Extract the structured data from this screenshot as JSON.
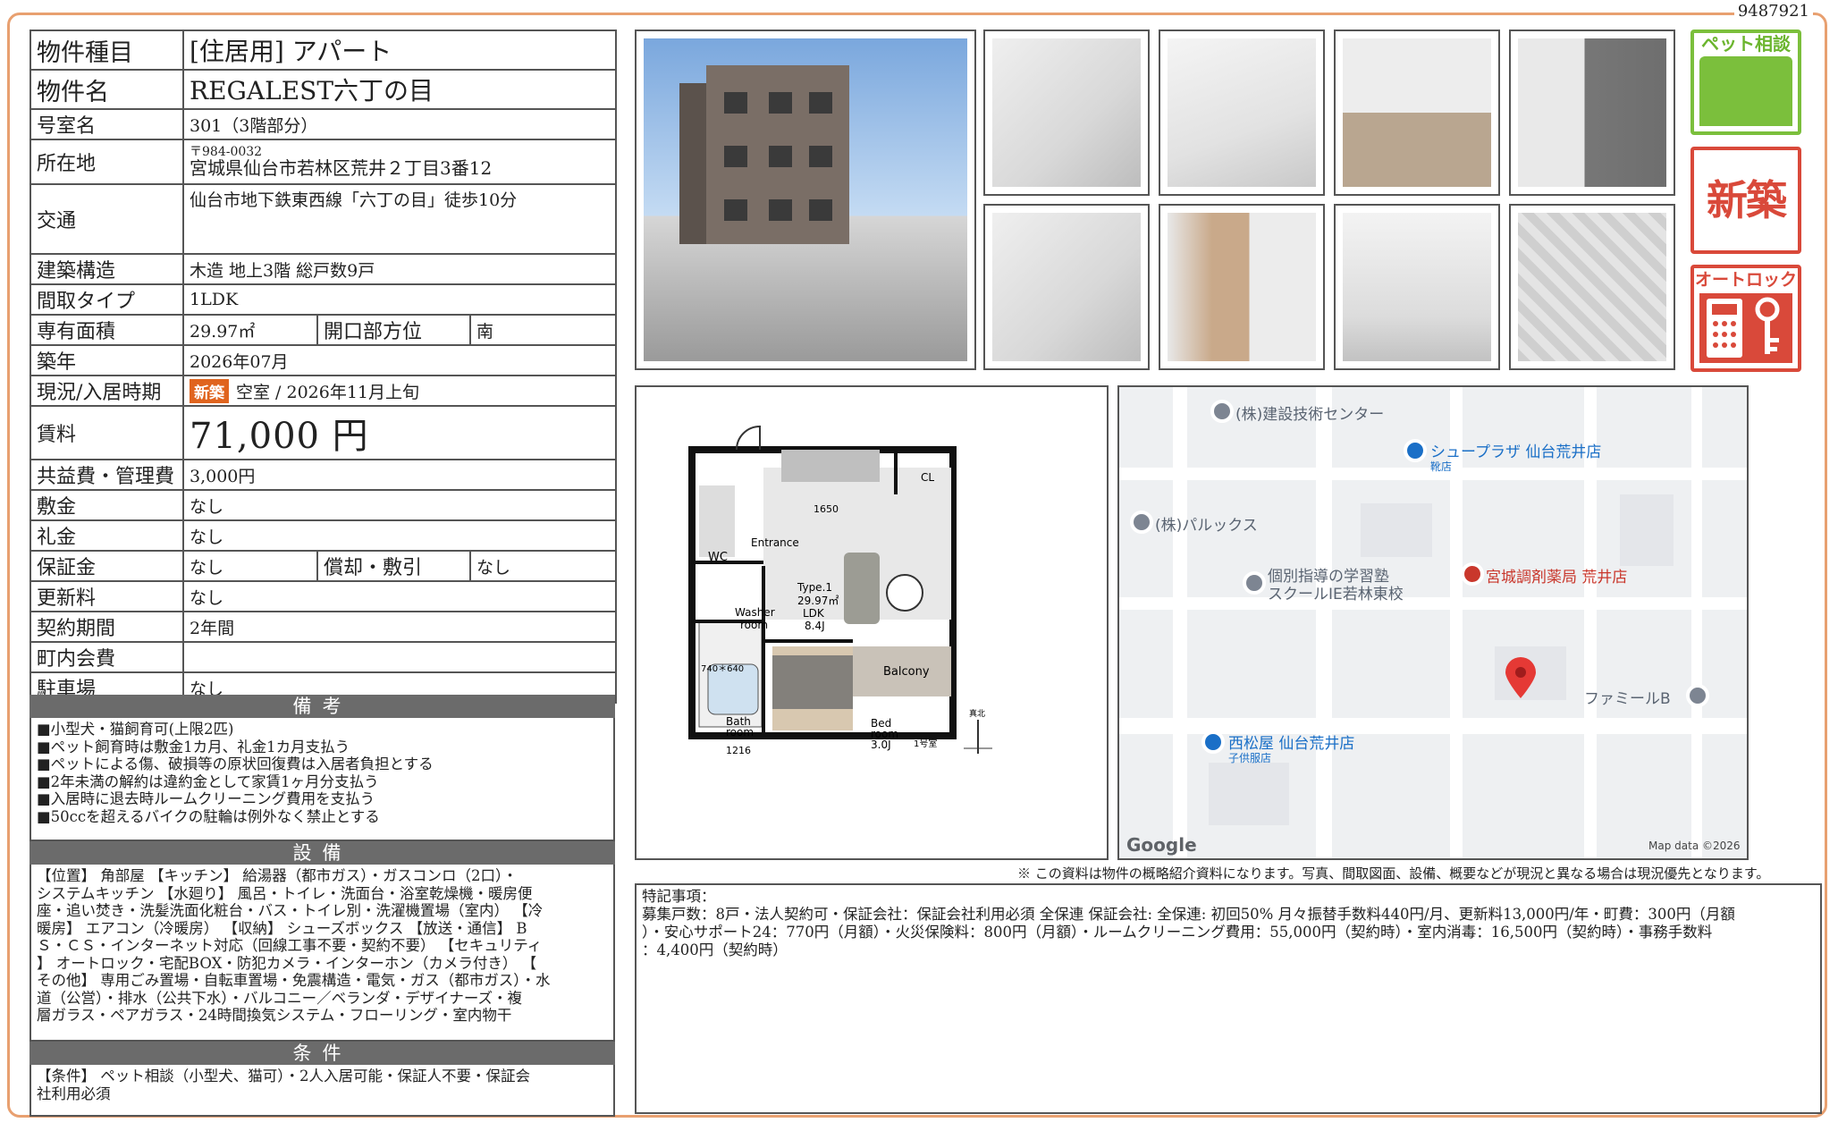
{
  "doc_id": "9487921",
  "rows": {
    "type": {
      "key": "物件種目",
      "val": "[住居用]  アパート"
    },
    "name": {
      "key": "物件名",
      "val": "REGALEST六丁の目"
    },
    "room": {
      "key": "号室名",
      "val": "301（3階部分）"
    },
    "address": {
      "key": "所在地",
      "zip": "〒984-0032",
      "val": "宮城県仙台市若林区荒井２丁目3番12"
    },
    "transport": {
      "key": "交通",
      "val": "仙台市地下鉄東西線「六丁の目」徒歩10分"
    },
    "structure": {
      "key": "建築構造",
      "val": "木造  地上3階  総戸数9戸"
    },
    "layout": {
      "key": "間取タイプ",
      "val": "1LDK"
    },
    "area": {
      "key": "専有面積",
      "val": "29.97㎡",
      "key2": "開口部方位",
      "val2": "南"
    },
    "built": {
      "key": "築年",
      "val": "2026年07月"
    },
    "status": {
      "key": "現況/入居時期",
      "badge": "新築",
      "val": "空室  /   2026年11月上旬"
    },
    "rent": {
      "key": "賃料",
      "val": "71,000 円"
    },
    "fee": {
      "key": "共益費・管理費",
      "val": "3,000円"
    },
    "deposit": {
      "key": "敷金",
      "val": "なし"
    },
    "key_money": {
      "key": "礼金",
      "val": "なし"
    },
    "guarantee": {
      "key": "保証金",
      "val": "なし",
      "key2": "償却・敷引",
      "val2": "なし"
    },
    "renewal": {
      "key": "更新料",
      "val": "なし"
    },
    "contract": {
      "key": "契約期間",
      "val": "2年間"
    },
    "neighborhood": {
      "key": "町内会費",
      "val": ""
    },
    "parking": {
      "key": "駐車場",
      "val": "なし"
    }
  },
  "remarks": {
    "title": "備考",
    "lines": [
      "■小型犬・猫飼育可(上限2匹)",
      "■ペット飼育時は敷金1カ月、礼金1カ月支払う",
      "■ペットによる傷、破損等の原状回復費は入居者負担とする",
      "■2年未満の解約は違約金として家賃1ヶ月分支払う",
      "■入居時に退去時ルームクリーニング費用を支払う",
      "■50ccを超えるバイクの駐輪は例外なく禁止とする"
    ]
  },
  "equipment": {
    "title": "設備",
    "lines": [
      "【位置】 角部屋 【キッチン】 給湯器（都市ガス）・ガスコンロ（2口）・",
      "システムキッチン 【水廻り】 風呂・トイレ・洗面台・浴室乾燥機・暖房便",
      "座・追い焚き・洗髪洗面化粧台・バス・トイレ別・洗濯機置場（室内） 【冷",
      "暖房】 エアコン（冷暖房） 【収納】 シューズボックス 【放送・通信】 B",
      "Ｓ・ＣＳ・インターネット対応（回線工事不要・契約不要） 【セキュリティ",
      "】 オートロック・宅配BOX・防犯カメラ・インターホン（カメラ付き） 【",
      "その他】 専用ごみ置場・自転車置場・免震構造・電気・ガス（都市ガス）・水",
      "道（公営）・排水（公共下水）・バルコニー／ベランダ・デザイナーズ・複",
      "層ガラス・ペアガラス・24時間換気システム・フローリング・室内物干"
    ]
  },
  "conditions": {
    "title": "条件",
    "lines": [
      "【条件】 ペット相談（小型犬、猫可）・2人入居可能・保証人不要・保証会",
      "社利用必須"
    ]
  },
  "icons": {
    "pet": "ペット相談",
    "new": "新築",
    "lock": "オートロック"
  },
  "plan": {
    "cl": "CL",
    "w1650": "1650",
    "entrance": "Entrance",
    "wc": "WC",
    "type": "Type.1",
    "area": "29.97㎡",
    "ldk": "LDK",
    "ldk_size": "8.4J",
    "washer": "Washer",
    "washer2": "room",
    "w740": "740＊640",
    "bath": "Bath",
    "bath2": "room",
    "w1216": "1216",
    "bed": "Bed",
    "bed2": "room",
    "bed_size": "3.0J",
    "balcony": "Balcony",
    "unit": "1号室",
    "north": "真北"
  },
  "map": {
    "labels": [
      "(株)建設技術センター",
      "シュープラザ 仙台荒井店",
      "靴店",
      "(株)パルックス",
      "個別指導の学習塾",
      "スクールIE若林東校",
      "宮城調剤薬局 荒井店",
      "ファミールB",
      "西松屋 仙台荒井店",
      "子供服店"
    ],
    "logo": "Google",
    "credit": "Map data ©2026",
    "colors": {
      "blue": "#1a6fc7",
      "red": "#c9372c",
      "pin": "#e53935"
    }
  },
  "notice": "※ この資料は物件の概略紹介資料になります。写真、間取図面、設備、概要などが現況と異なる場合は現況優先となります。",
  "special": {
    "title": "特記事項：",
    "lines": [
      "募集戸数：8戸・法人契約可・保証会社：保証会社利用必須 全保連 保証会社: 全保連: 初回50% 月々振替手数料440円/月、更新料13,000円/年・町費：300円（月額",
      "）・安心サポート24：770円（月額）・火災保険料：800円（月額）・ルームクリーニング費用：55,000円（契約時）・室内消毒：16,500円（契約時）・事務手数料",
      "：4,400円（契約時）"
    ]
  }
}
